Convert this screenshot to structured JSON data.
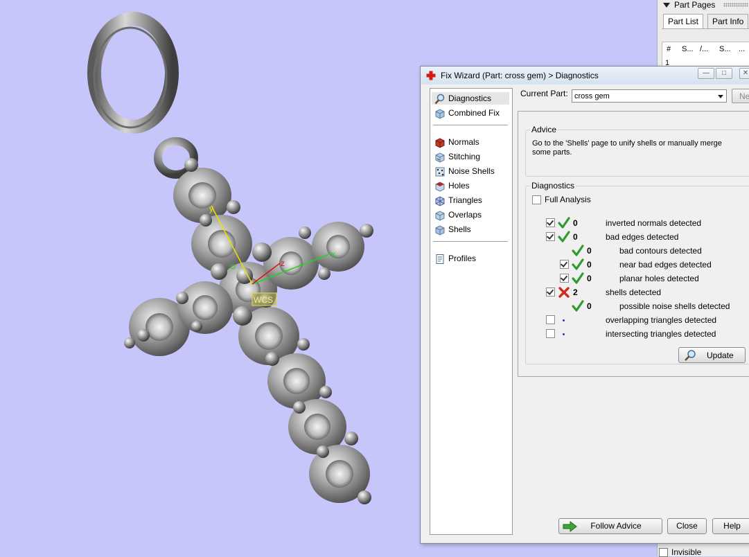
{
  "partpanel": {
    "header": "Part Pages",
    "tabs": [
      "Part List",
      "Part Info"
    ],
    "columns": [
      "#",
      "S...",
      "/...",
      "S...",
      "..."
    ],
    "first_row": "1",
    "invisible_label": "Invisible"
  },
  "viewport": {
    "wcs_label": "WCS",
    "axes": {
      "x": "x",
      "y": "y",
      "z": "z"
    }
  },
  "dialog": {
    "title": "Fix Wizard (Part: cross gem) > Diagnostics",
    "current_part_label": "Current Part:",
    "current_part_value": "cross gem",
    "next_label": "Ne",
    "nav": [
      {
        "label": "Diagnostics",
        "icon": "magnifier-icon"
      },
      {
        "label": "Combined Fix",
        "icon": "combined-fix-icon"
      },
      {
        "label": "Normals",
        "icon": "normals-icon"
      },
      {
        "label": "Stitching",
        "icon": "stitching-icon"
      },
      {
        "label": "Noise Shells",
        "icon": "noise-shells-icon"
      },
      {
        "label": "Holes",
        "icon": "holes-icon"
      },
      {
        "label": "Triangles",
        "icon": "triangles-icon"
      },
      {
        "label": "Overlaps",
        "icon": "overlaps-icon"
      },
      {
        "label": "Shells",
        "icon": "shells-icon"
      },
      {
        "label": "Profiles",
        "icon": "profiles-icon"
      }
    ],
    "advice": {
      "legend": "Advice",
      "text": "Go to the 'Shells' page to unify shells or manually merge some parts."
    },
    "diagnostics": {
      "legend": "Diagnostics",
      "full_analysis_label": "Full Analysis",
      "rows": [
        {
          "checked": true,
          "status": "ok",
          "count": "0",
          "label": "inverted normals detected",
          "indent": 0
        },
        {
          "checked": true,
          "status": "ok",
          "count": "0",
          "label": "bad edges detected",
          "indent": 0
        },
        {
          "checked": null,
          "status": "ok",
          "count": "0",
          "label": "bad contours detected",
          "indent": 1
        },
        {
          "checked": true,
          "status": "ok",
          "count": "0",
          "label": "near bad edges detected",
          "indent": 1
        },
        {
          "checked": true,
          "status": "ok",
          "count": "0",
          "label": "planar holes detected",
          "indent": 1
        },
        {
          "checked": true,
          "status": "error",
          "count": "2",
          "label": "shells detected",
          "indent": 0
        },
        {
          "checked": null,
          "status": "ok",
          "count": "0",
          "label": "possible noise shells detected",
          "indent": 1
        },
        {
          "checked": false,
          "status": "none",
          "count": "",
          "label": "overlapping triangles detected",
          "indent": 0
        },
        {
          "checked": false,
          "status": "none",
          "count": "",
          "label": "intersecting triangles detected",
          "indent": 0
        }
      ],
      "update_label": "Update"
    },
    "buttons": {
      "follow_advice": "Follow Advice",
      "close": "Close",
      "help": "Help"
    }
  },
  "colors": {
    "background": "#c6c6fb",
    "check_green": "#2f9a2f",
    "cross_red": "#d42a1a"
  }
}
